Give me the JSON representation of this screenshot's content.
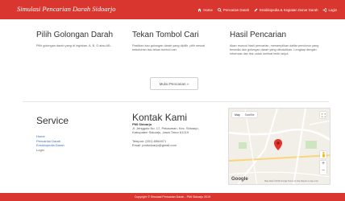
{
  "app": {
    "title": "Simulasi Pencarian Darah Sidoarjo"
  },
  "nav": {
    "items": [
      {
        "label": "Home",
        "icon": "home-icon"
      },
      {
        "label": "Pencarian Darah",
        "icon": "search-icon"
      },
      {
        "label": "Ensiklopedia & Kegiatan Donor Darah",
        "icon": "pencil-icon"
      },
      {
        "label": "Login",
        "icon": "login-icon"
      }
    ]
  },
  "features": [
    {
      "title": "Pilih Golongan Darah",
      "text": "Pilih golongan darah yang di inginkan, A, B, O atau AB."
    },
    {
      "title": "Tekan Tombol Cari",
      "text": "Pastikan kau golongan darah yang dipilih, pilih sesuai kebutuhan lalu tekan tombol cari."
    },
    {
      "title": "Hasil Pencarian",
      "text": "Akan muncul hasil pencarian, menampilkan daftar pendonor yang tersedia dan golongan darah yang dibutuhkan. Lengkap dengan informasi dan link untuk melihat lebih lanjut."
    }
  ],
  "start_button": {
    "label": "Mulai Pencarian »"
  },
  "service": {
    "title": "Service",
    "links": [
      "Home",
      "Pencarian Darah",
      "Ensiklopedia Darah"
    ],
    "plain": "Login"
  },
  "contact": {
    "title": "Kontak Kami",
    "org": "PMI Sidoarjo",
    "address1": "Jl. Jenggolo No. 17, Pekauman, Kec. Sidoarjo,",
    "address2": "Kabupaten Sidoarjo, Jawa Timur 61219",
    "phone": "Telepon: (031) 8964971",
    "email": "Email: pmisidoarjo@gmail.com"
  },
  "map": {
    "tab_map": "Map",
    "tab_satellite": "Satellite",
    "logo": "Google",
    "attribution": "Map data ©2019 Google  Terms of Use  Report a map error",
    "marker_color": "#e0342c"
  },
  "footer": {
    "text": "Copyright © Simulasi Pencarian Darah - PMI Sidoarjo 2019"
  },
  "colors": {
    "accent": "#d9362f",
    "link": "#3b70b8"
  }
}
